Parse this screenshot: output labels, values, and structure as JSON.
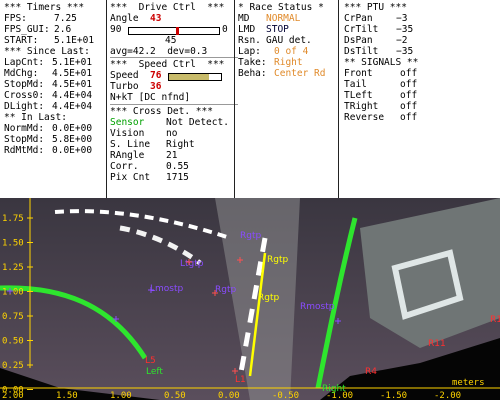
{
  "timers": {
    "header": "*** Timers ***",
    "rows": [
      {
        "label": "FPS:",
        "value": "7.25"
      },
      {
        "label": "FPS_GUI:",
        "value": "2.6"
      },
      {
        "label": "START:",
        "value": "5.1E+01"
      }
    ],
    "since_header": "*** Since Last:",
    "since_rows": [
      {
        "label": "LapCnt:",
        "value": "5.1E+01"
      },
      {
        "label": "MdChg:",
        "value": "4.5E+01"
      },
      {
        "label": "StopMd:",
        "value": "4.5E+01"
      },
      {
        "label": "Cross0:",
        "value": "4.4E+04"
      },
      {
        "label": "DLight:",
        "value": "4.4E+04"
      }
    ],
    "inlast_header": "** In Last:",
    "inlast_rows": [
      {
        "label": "NormMd:",
        "value": "0.0E+00"
      },
      {
        "label": "StopMd:",
        "value": "5.8E+00"
      },
      {
        "label": "RdMtMd:",
        "value": "0.0E+00"
      }
    ]
  },
  "drive": {
    "header": "***  Drive Ctrl  ***",
    "angle_label": "Angle",
    "angle_value": "43",
    "angle_min": "90",
    "angle_max": "0",
    "angle_level_percent": 52,
    "angle_center": "45",
    "avg_dev": "avg=42.2  dev=0.3",
    "speed_header": "***  Speed Ctrl  ***",
    "speed_label": "Speed",
    "speed_value": "76",
    "speed_level_percent": 76,
    "turbo_label": "Turbo",
    "turbo_value": "36",
    "nnt": "N+kT [DC nfnd]",
    "cross_header": "*** Cross Det. ***",
    "cross_rows": [
      {
        "label": "Sensor",
        "value": "Not Detect.",
        "color": "#00a000"
      },
      {
        "label": "Vision",
        "value": "no"
      },
      {
        "label": "S. Line",
        "value": "Right"
      },
      {
        "label": "RAngle",
        "value": "21"
      },
      {
        "label": "Corr.",
        "value": "0.55"
      },
      {
        "label": "Pix Cnt",
        "value": "1715"
      }
    ]
  },
  "race": {
    "header": "* Race Status *",
    "md_label": "MD",
    "md_value": "NORMAL",
    "lmd_label": "LMD",
    "lmd_value": "STOP",
    "rsn_label": "Rsn.",
    "rsn_value": "GAU det.",
    "lap_label": "Lap:",
    "lap_value": "0 of 4",
    "take_label": "Take:",
    "take_value": "Right",
    "beha_label": "Beha:",
    "beha_value": "Center Rd"
  },
  "ptu": {
    "header": "*** PTU ***",
    "rows": [
      {
        "label": "CrPan",
        "value": "−3"
      },
      {
        "label": "CrTilt",
        "value": "−35"
      },
      {
        "label": "DsPan",
        "value": "−2"
      },
      {
        "label": "DsTilt",
        "value": "−35"
      }
    ],
    "signals_header": "** SIGNALS **",
    "signals": [
      {
        "label": "Front",
        "value": "off"
      },
      {
        "label": "Tail",
        "value": "off"
      },
      {
        "label": "TLeft",
        "value": "off"
      },
      {
        "label": "TRight",
        "value": "off"
      },
      {
        "label": "Reverse",
        "value": "off"
      }
    ]
  },
  "scene": {
    "y_ticks": [
      "1.75",
      "1.50",
      "1.25",
      "1.00",
      "0.75",
      "0.50",
      "0.25",
      "0.00"
    ],
    "x_ticks": [
      "2.00",
      "1.50",
      "1.00",
      "0.50",
      "0.00",
      "-0.50",
      "-1.00",
      "-1.50",
      "-2.00"
    ],
    "units": "meters",
    "labels": {
      "ltgtp": "Ltgtp",
      "rgtp_top": "Rgtp",
      "rgtp_mid": "Rgtp",
      "lmostp": "Lmostp",
      "rmostp": "Rmostp",
      "left": "Left",
      "right": "Right",
      "l5": "L5",
      "r11": "R11",
      "r15": "R15",
      "l1": "L1",
      "r4": "R4",
      "rgtp_top2": "Rgtp"
    },
    "colors": {
      "axis": "#ffd400",
      "lane_green": "#2ee52e",
      "target_yellow": "#ffff00",
      "marker_purple": "#8a4cff",
      "marker_red": "#ff3030"
    }
  }
}
